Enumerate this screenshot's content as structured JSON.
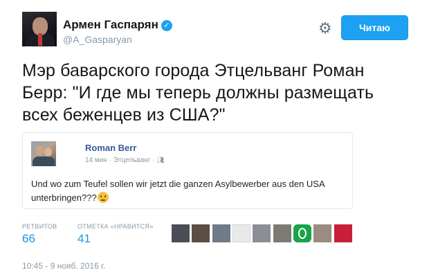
{
  "author": {
    "name": "Армен Гаспарян",
    "handle": "@A_Gasparyan",
    "verified": true
  },
  "follow_button": {
    "label": "Читаю",
    "color": "#1da1f2"
  },
  "settings_icon": "gear-icon",
  "tweet": {
    "text": "Мэр баварского города Этцельванг Роман Берр: \"И где мы теперь должны размещать всех беженцев из США?\""
  },
  "quoted_post": {
    "author_name": "Roman Berr",
    "meta": "14 мин · Этцельванг ·",
    "privacy_icon": "people-icon",
    "text": "Und wo zum Teufel sollen wir jetzt die ganzen Asylbewerber aus den USA unterbringen???",
    "emoji_icon": "thinking-face-icon"
  },
  "stats": {
    "retweets_label": "РЕТВИТОВ",
    "retweets_count": "66",
    "likes_label": "ОТМЕТКА «НРАВИТСЯ»",
    "likes_count": "41"
  },
  "likers": [
    {
      "name": "liker-avatar-1",
      "color": "#4a4f57"
    },
    {
      "name": "liker-avatar-2",
      "color": "#5a4e45"
    },
    {
      "name": "liker-avatar-3",
      "color": "#6f7b86"
    },
    {
      "name": "liker-avatar-4",
      "color": "#e9e9ea"
    },
    {
      "name": "liker-avatar-5",
      "color": "#8a8f96"
    },
    {
      "name": "liker-avatar-6",
      "color": "#7d7a74"
    },
    {
      "name": "liker-avatar-7",
      "color": "#1aa34a"
    },
    {
      "name": "liker-avatar-8",
      "color": "#9a8c80"
    },
    {
      "name": "liker-avatar-9",
      "color": "#c8203a"
    }
  ],
  "timestamp": "10:45 - 9 нояб. 2016 г."
}
